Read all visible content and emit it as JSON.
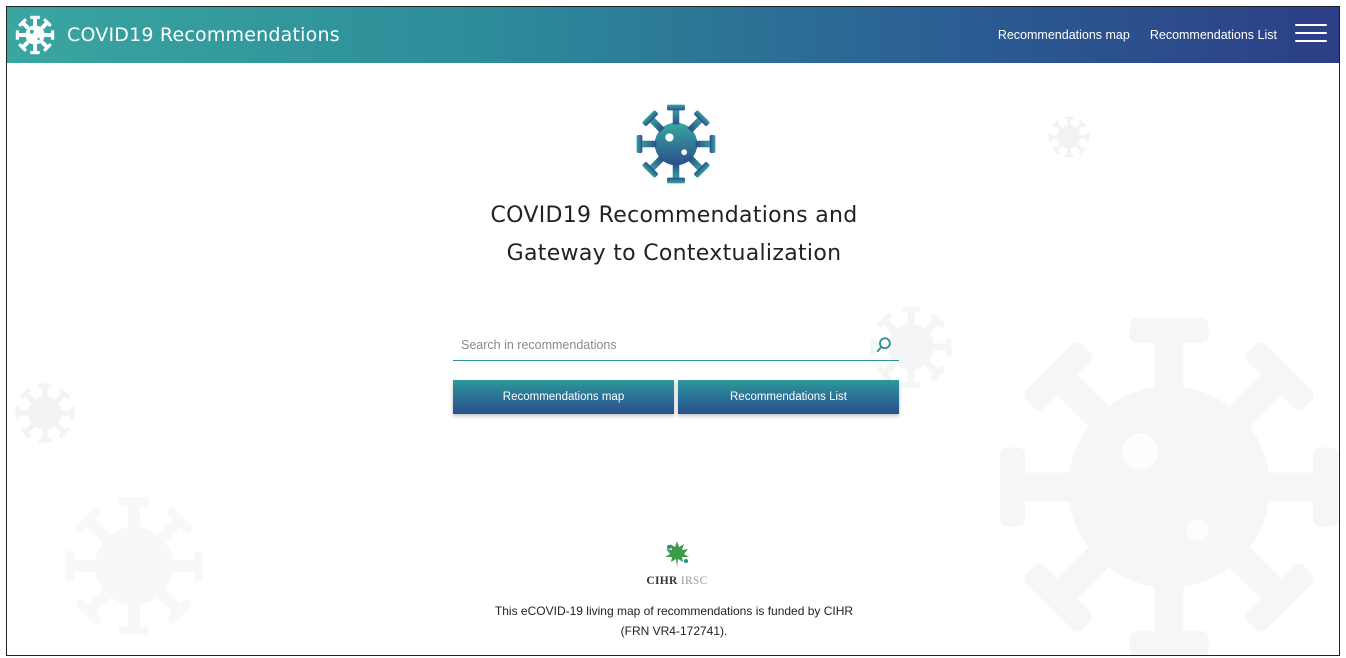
{
  "header": {
    "brand_title": "COVID19 Recommendations",
    "brand_icon": "virus-icon",
    "nav_links": [
      {
        "label": "Recommendations map"
      },
      {
        "label": "Recommendations List"
      }
    ],
    "menu_icon": "hamburger-menu-icon"
  },
  "hero": {
    "icon": "virus-icon",
    "title_line1": "COVID19 Recommendations and",
    "title_line2": "Gateway to Contextualization"
  },
  "search": {
    "placeholder": "Search in recommendations",
    "value": "",
    "icon": "search-icon"
  },
  "buttons": {
    "map_label": "Recommendations map",
    "list_label": "Recommendations List"
  },
  "footer": {
    "logo_strong": "CIHR",
    "logo_light": "IRSC",
    "funding_line1": "This eCOVID-19 living map of recommendations is funded by CIHR",
    "funding_line2": "(FRN VR4-172741)."
  },
  "colors": {
    "header_gradient_start": "#3aa6a0",
    "header_gradient_end": "#2c3e87",
    "accent_teal": "#2f8f94"
  }
}
